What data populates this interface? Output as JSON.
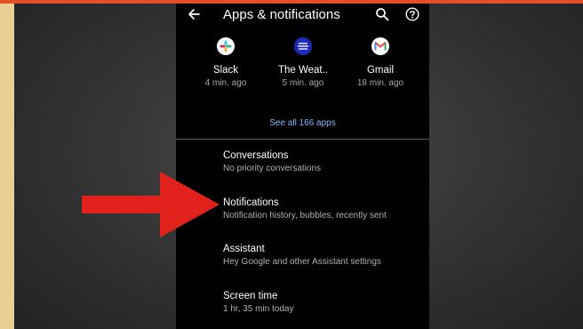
{
  "header": {
    "title": "Apps & notifications"
  },
  "recent_apps": [
    {
      "name": "Slack",
      "time": "4 min. ago",
      "icon": "slack-icon"
    },
    {
      "name": "The Weat..",
      "time": "5 min. ago",
      "icon": "weather-channel-icon"
    },
    {
      "name": "Gmail",
      "time": "18 min. ago",
      "icon": "gmail-icon"
    }
  ],
  "see_all": "See all 166 apps",
  "menu": [
    {
      "title": "Conversations",
      "subtitle": "No priority conversations"
    },
    {
      "title": "Notifications",
      "subtitle": "Notification history, bubbles, recently sent"
    },
    {
      "title": "Assistant",
      "subtitle": "Hey Google and other Assistant settings"
    },
    {
      "title": "Screen time",
      "subtitle": "1 hr, 35 min today"
    }
  ],
  "colors": {
    "page_bg": "#e9cf94",
    "top_strip": "#e2502a",
    "screen_bg": "#000000",
    "link": "#8ab4f8",
    "arrow": "#e0211c"
  },
  "icons": [
    "back-arrow-icon",
    "search-icon",
    "help-icon"
  ]
}
